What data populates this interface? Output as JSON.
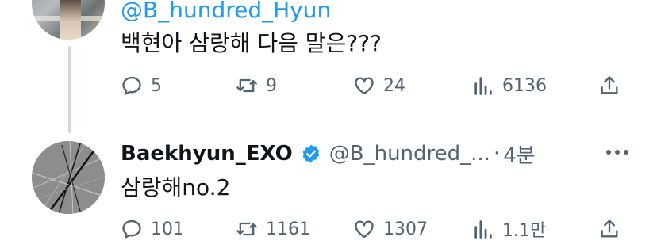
{
  "parent_tweet": {
    "handle": "@B_hundred_Hyun",
    "text": "백현아 삼랑해 다음 말은???",
    "replies": "5",
    "retweets": "9",
    "likes": "24",
    "views": "6136"
  },
  "reply_tweet": {
    "display_name": "Baekhyun_EXO",
    "handle": "@B_hundred_...",
    "separator": "·",
    "time": "4분",
    "text": "삼랑해no.2",
    "replies": "101",
    "retweets": "1161",
    "likes": "1307",
    "views": "1.1만"
  },
  "colors": {
    "link": "#1d9bf0",
    "verified": "#1d9bf0",
    "secondary_text": "#536471",
    "thread_line": "#cfd9de"
  },
  "icons": [
    "reply-icon",
    "retweet-icon",
    "like-icon",
    "views-icon",
    "share-icon",
    "verified-badge-icon",
    "more-options-icon"
  ]
}
